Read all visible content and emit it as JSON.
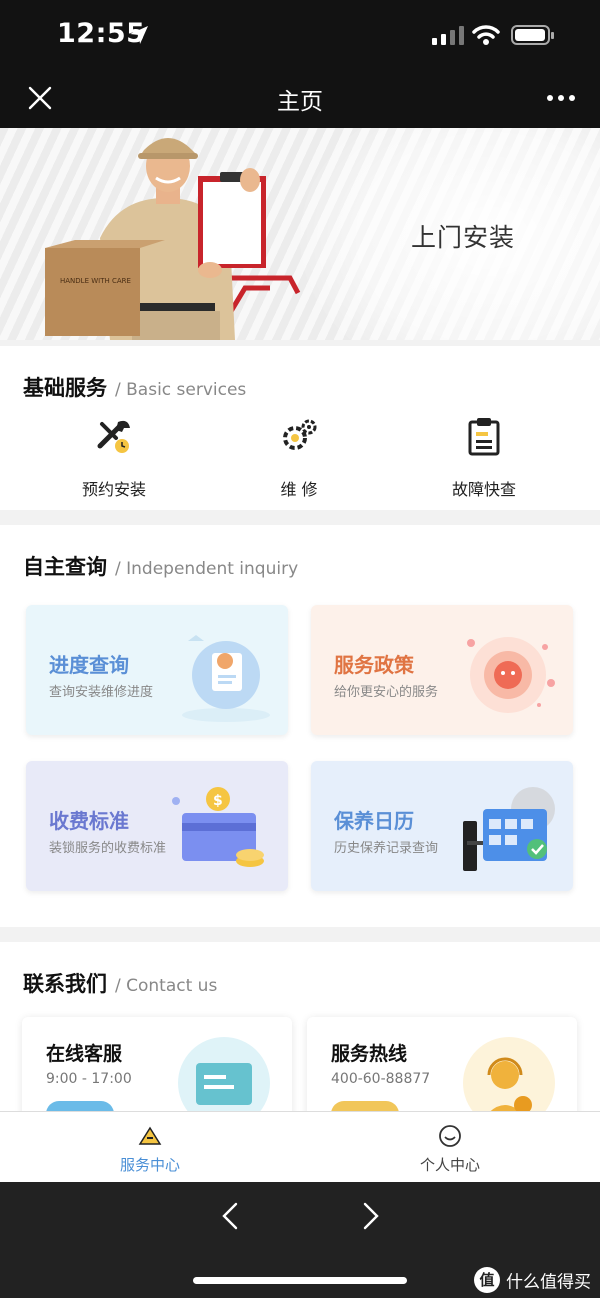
{
  "status_bar": {
    "time": "12:55"
  },
  "nav": {
    "title": "主页"
  },
  "banner": {
    "text": "上门安装",
    "box_label": "HANDLE WITH CARE"
  },
  "basic_services": {
    "title": "基础服务",
    "subtitle": "/ Basic services",
    "items": [
      {
        "label": "预约安装",
        "icon": "wrench-icon"
      },
      {
        "label": "维 修",
        "icon": "gears-icon"
      },
      {
        "label": "故障快查",
        "icon": "clipboard-icon"
      }
    ]
  },
  "inquiry": {
    "title": "自主查询",
    "subtitle": "/ Independent inquiry",
    "cards": [
      {
        "title": "进度查询",
        "desc": "查询安装维修进度",
        "color": "#5a8fd6",
        "bg": "#e9f6fb"
      },
      {
        "title": "服务政策",
        "desc": "给你更安心的服务",
        "color": "#e07443",
        "bg": "#fdf1ea"
      },
      {
        "title": "收费标准",
        "desc": "装锁服务的收费标准",
        "color": "#6a78d0",
        "bg": "#e8eaf8"
      },
      {
        "title": "保养日历",
        "desc": "历史保养记录查询",
        "color": "#5a8fd6",
        "bg": "#e6effb"
      }
    ]
  },
  "contact": {
    "title": "联系我们",
    "subtitle": "/ Contact us",
    "cards": [
      {
        "title": "在线客服",
        "desc": "9:00 - 17:00",
        "pill_color": "#6bbbe8"
      },
      {
        "title": "服务热线",
        "desc": "400-60-88877",
        "pill_color": "#f1c65a"
      }
    ]
  },
  "tabbar": {
    "items": [
      {
        "label": "服务中心",
        "active": true,
        "color": "#4a8fd6"
      },
      {
        "label": "个人中心",
        "active": false,
        "color": "#444444"
      }
    ]
  },
  "watermark": {
    "badge": "值",
    "text": "什么值得买"
  }
}
